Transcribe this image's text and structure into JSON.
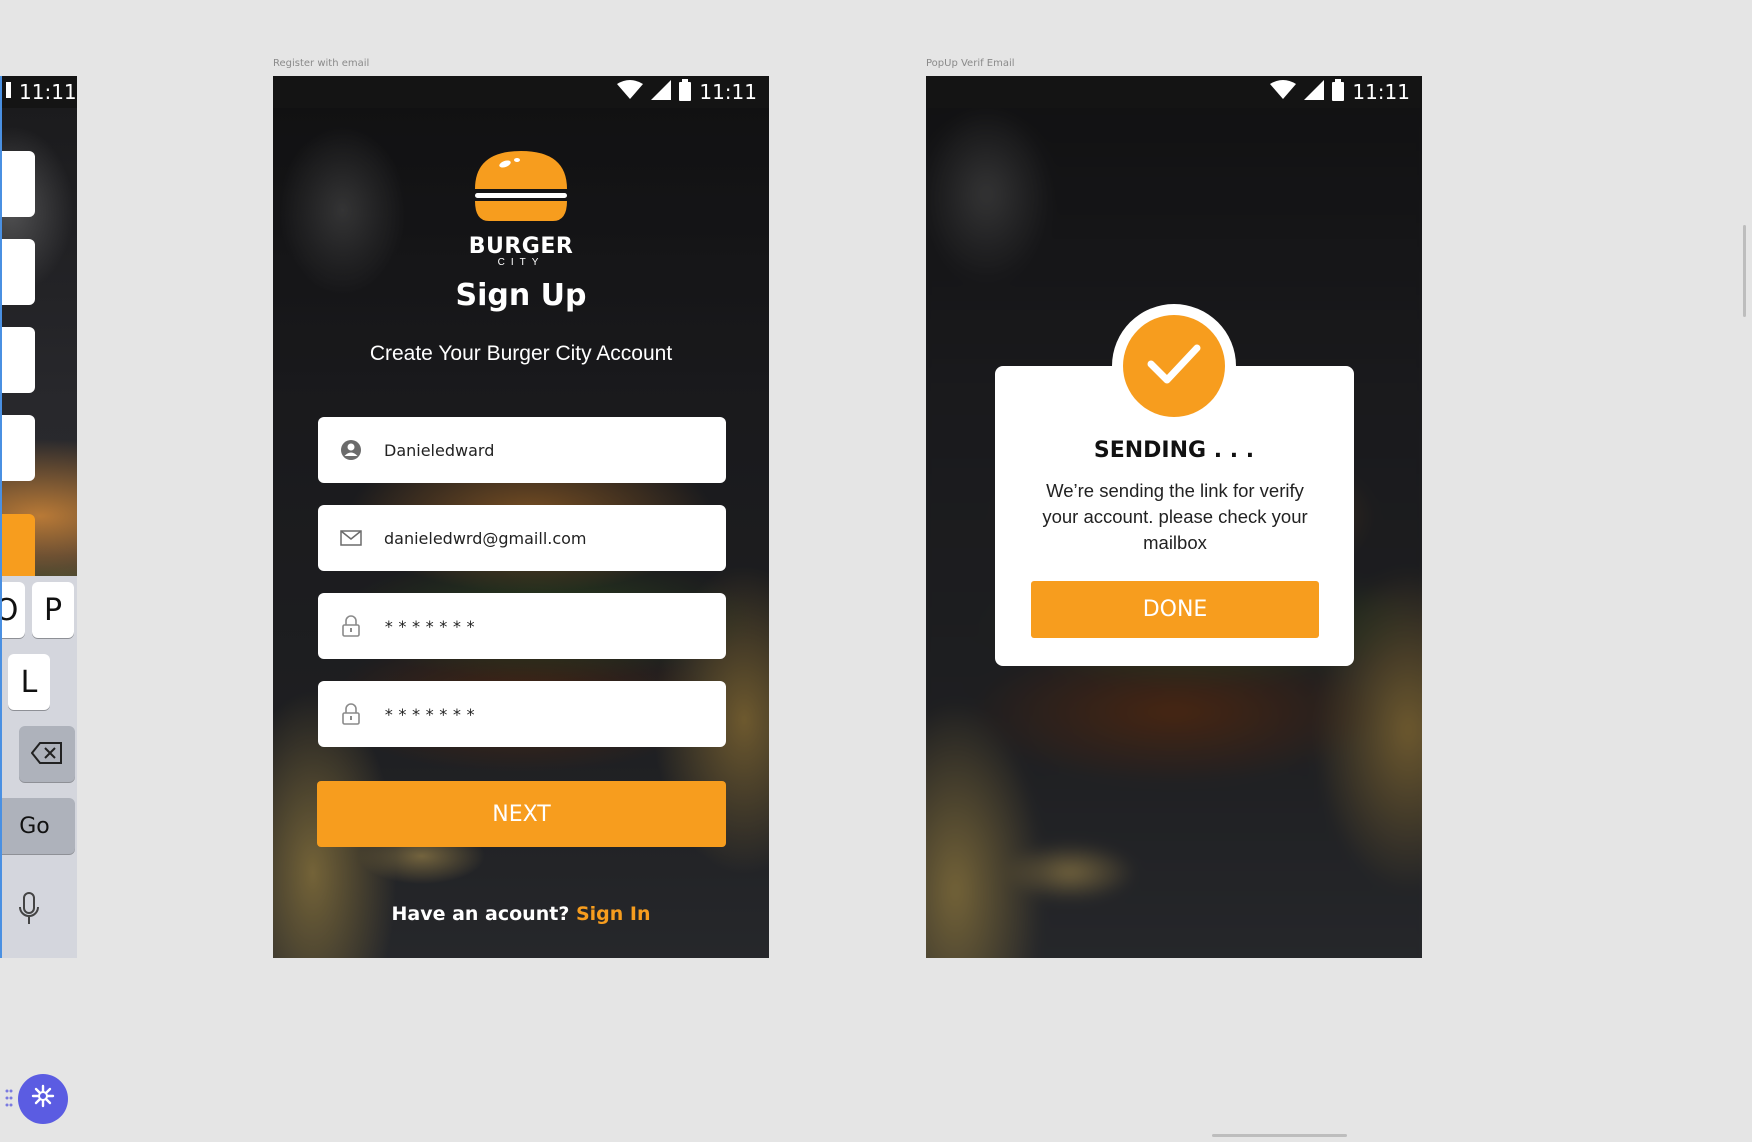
{
  "status": {
    "time": "11:11"
  },
  "left_frame": {
    "keys": {
      "o_partial": "O",
      "p": "P",
      "l": "L",
      "go": "Go"
    }
  },
  "signup": {
    "frame_label": "Register with email",
    "logo": {
      "word": "BURGER",
      "sub": "CITY"
    },
    "title": "Sign Up",
    "subtitle": "Create Your Burger City Account",
    "fields": {
      "username": "Danieledward",
      "email": "danieledwrd@gmaill.com",
      "password": "*******",
      "confirm_password": "*******"
    },
    "next_label": "NEXT",
    "have_account": "Have an acount?",
    "sign_in": "Sign In"
  },
  "popup": {
    "frame_label": "PopUp Verif Email",
    "heading": "SENDING . . .",
    "message": "We’re sending the link for verify your account. please check your mailbox",
    "done_label": "DONE"
  },
  "colors": {
    "accent": "#f79d1e",
    "canvas": "#e5e5e5",
    "fab": "#5b5ce2"
  },
  "icons": [
    "wifi-icon",
    "signal-icon",
    "battery-icon",
    "user-icon",
    "mail-icon",
    "lock-icon",
    "checkmark-icon",
    "backspace-icon",
    "microphone-icon",
    "plugin-icon",
    "drag-handle-icon"
  ]
}
